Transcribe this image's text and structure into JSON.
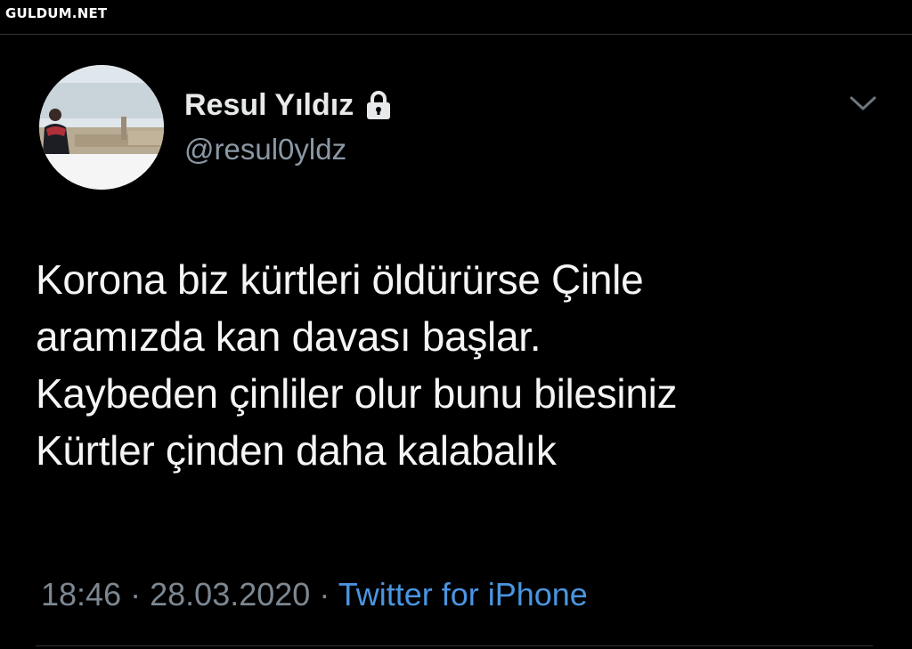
{
  "watermark": "GULDUM.NET",
  "tweet": {
    "author": {
      "display_name": "Resul Yıldız",
      "handle": "@resul0yldz",
      "protected_icon": "lock-icon",
      "avatar_icon": "avatar-photo"
    },
    "more_icon": "chevron-down-icon",
    "text_lines": [
      "Korona biz kürtleri öldürürse Çinle",
      "aramızda kan davası başlar.",
      "Kaybeden çinliler olur bunu bilesiniz",
      "Kürtler çinden daha kalabalık"
    ],
    "time": "18:46",
    "separator": "·",
    "date": "28.03.2020",
    "source": "Twitter for iPhone"
  },
  "colors": {
    "background": "#000000",
    "primary_text": "#e7e9ea",
    "secondary_text": "#8b98a5",
    "link": "#4a95e0",
    "divider": "#2f3336"
  }
}
